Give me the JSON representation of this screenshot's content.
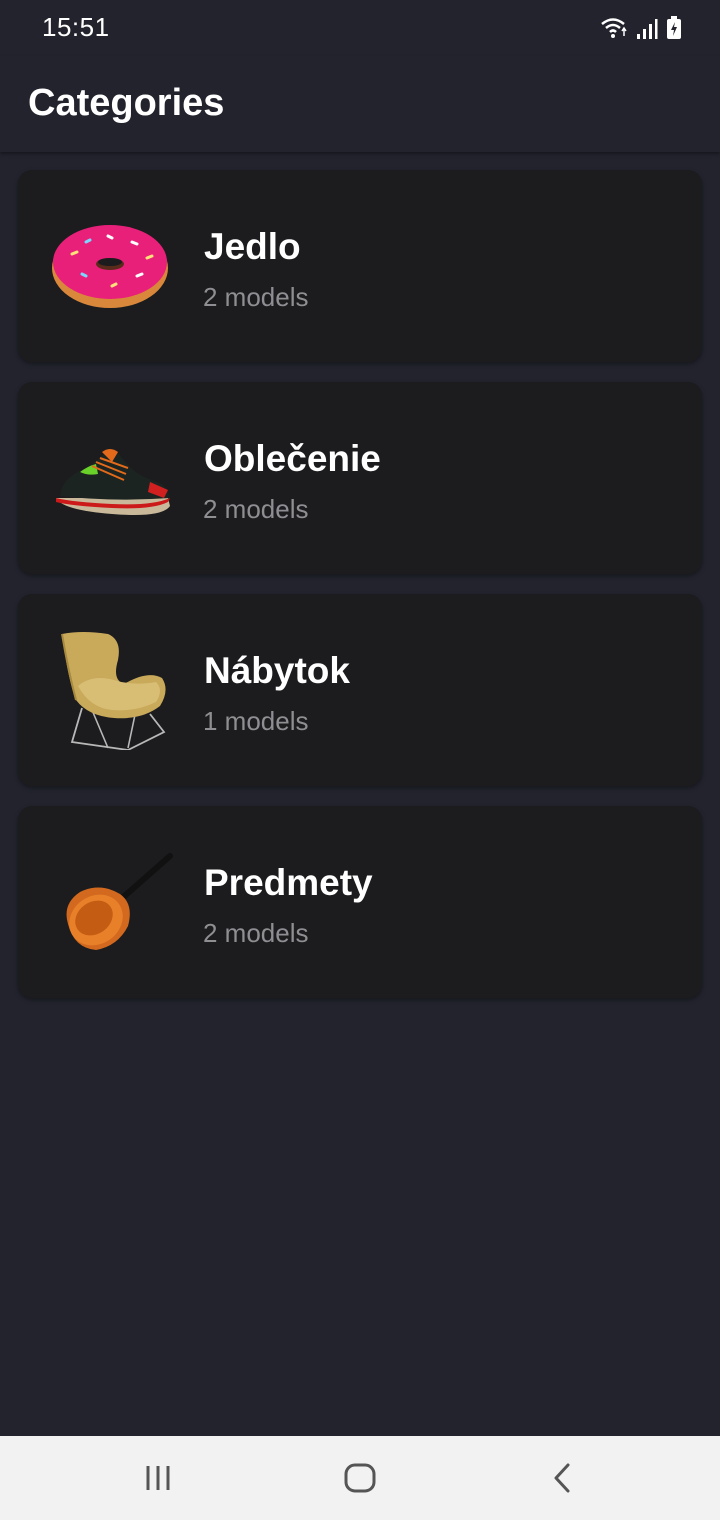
{
  "status": {
    "time": "15:51"
  },
  "header": {
    "title": "Categories"
  },
  "categories": [
    {
      "name": "Jedlo",
      "count": "2 models",
      "icon": "donut-icon"
    },
    {
      "name": "Oblečenie",
      "count": "2 models",
      "icon": "sneaker-icon"
    },
    {
      "name": "Nábytok",
      "count": "1 models",
      "icon": "chair-icon"
    },
    {
      "name": "Predmety",
      "count": "2 models",
      "icon": "pan-icon"
    }
  ],
  "navigation": {
    "buttons": [
      "recents-icon",
      "home-icon",
      "back-icon"
    ]
  },
  "colors": {
    "background": "#22232d",
    "card": "#1c1c1e",
    "subtitle": "#8e8e93",
    "navbar": "#f2f2f2"
  }
}
